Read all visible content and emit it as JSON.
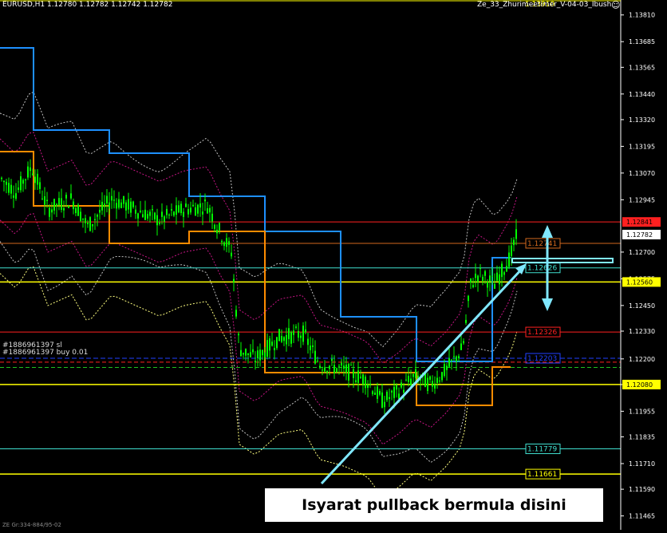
{
  "header": {
    "symbol_info": "EURUSD,H1  1.12780 1.12782 1.12742 1.12782",
    "ea_label": "Ze_33_Zhurimeetimer_V-04-03_Ibush"
  },
  "chart_data": {
    "type": "candlestick",
    "ylim": [
      1.114,
      1.1388
    ],
    "y_ticks": [
      "1.13810",
      "1.13685",
      "1.13565",
      "1.13440",
      "1.13320",
      "1.13195",
      "1.13070",
      "1.12945",
      "1.12700",
      "1.12575",
      "1.12450",
      "1.12330",
      "1.12200",
      "1.12080",
      "1.11955",
      "1.11835",
      "1.11710",
      "1.11590",
      "1.11465"
    ],
    "price_tags": [
      {
        "price": 1.12841,
        "text": "1.12841",
        "color": "#ff2020"
      },
      {
        "price": 1.12782,
        "text": "1.12782",
        "color": "#ffffff"
      },
      {
        "price": 1.1256,
        "text": "1.12560",
        "color": "#ffff00"
      },
      {
        "price": 1.1208,
        "text": "1.12080",
        "color": "#ffff00"
      }
    ],
    "level_lines": [
      {
        "price": 1.12841,
        "color": "#ff2020",
        "label": ""
      },
      {
        "price": 1.12741,
        "color": "#d2691e",
        "label": "1.12741"
      },
      {
        "price": 1.12626,
        "color": "#40e0d0",
        "label": "1.12626"
      },
      {
        "price": 1.1256,
        "color": "#ffff00",
        "label": ""
      },
      {
        "price": 1.12326,
        "color": "#ff2020",
        "label": "1.12326"
      },
      {
        "price": 1.12203,
        "color": "#2040ff",
        "label": "1.12203"
      },
      {
        "price": 1.1208,
        "color": "#ffff00",
        "label": ""
      },
      {
        "price": 1.11779,
        "color": "#40e0d0",
        "label": "1.11779"
      },
      {
        "price": 1.11661,
        "color": "#ffff00",
        "label": "1.11661"
      }
    ],
    "top_label": "1.13910"
  },
  "orders": {
    "sl_label": "#1886961397 sl",
    "buy_label": "#1886961397 buy 0.01"
  },
  "annotation": {
    "text": "Isyarat pullback bermula disini"
  },
  "footer": {
    "label": "ZE Gr:334-884/95-02"
  },
  "colors": {
    "candle": "#00ff00",
    "blue_channel": "#1e90ff",
    "orange_channel": "#ff8c00",
    "arrow": "#80e8ff",
    "grid": "#1a1a1a"
  }
}
